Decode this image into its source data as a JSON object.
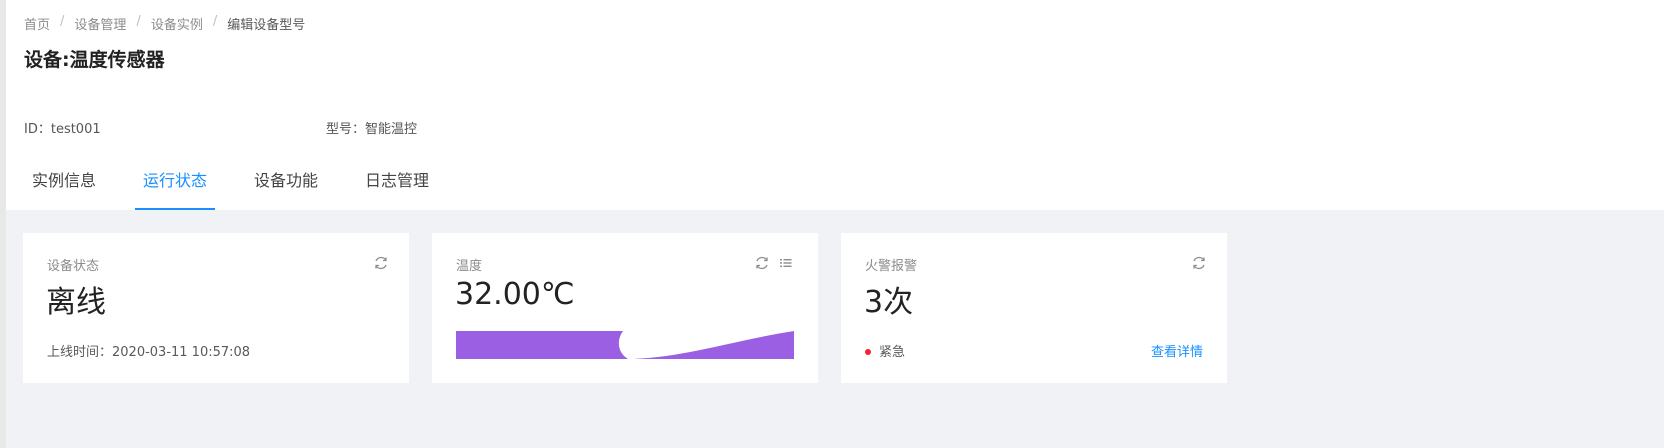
{
  "breadcrumb": [
    "首页",
    "设备管理",
    "设备实例",
    "编辑设备型号"
  ],
  "breadcrumb_separator": "/",
  "page_title": "设备:温度传感器",
  "meta": {
    "id_label": "ID：test001",
    "model_label": "型号：智能温控"
  },
  "tabs": [
    {
      "label": "实例信息",
      "active": false
    },
    {
      "label": "运行状态",
      "active": true
    },
    {
      "label": "设备功能",
      "active": false
    },
    {
      "label": "日志管理",
      "active": false
    }
  ],
  "cards": {
    "status": {
      "label": "设备状态",
      "value": "离线",
      "footer": "上线时间：2020-03-11 10:57:08",
      "icons": [
        "refresh-icon"
      ]
    },
    "temperature": {
      "label": "温度",
      "value": "32.00℃",
      "icons": [
        "refresh-icon",
        "list-icon"
      ],
      "chart_color": "#9a5fe2"
    },
    "fire_alarm": {
      "label": "火警报警",
      "value": "3次",
      "level": "紧急",
      "level_color": "#f5222d",
      "link": "查看详情",
      "icons": [
        "refresh-icon"
      ]
    }
  },
  "colors": {
    "accent": "#1890ff",
    "background": "#f0f2f5"
  }
}
